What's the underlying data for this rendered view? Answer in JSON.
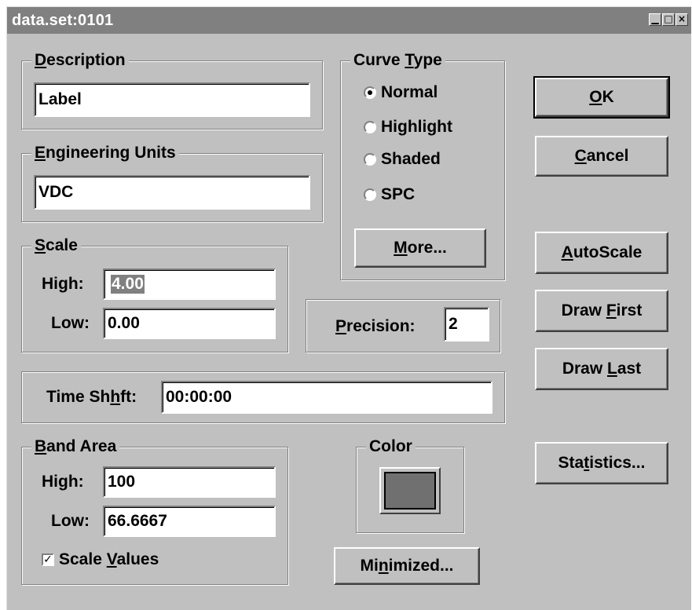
{
  "window": {
    "title": "data.set:0101",
    "controls": [
      "minimize-icon",
      "maximize-icon",
      "close-icon"
    ]
  },
  "description": {
    "group": "Description",
    "value": "Label"
  },
  "engineering_units": {
    "group": "Engineering Units",
    "value": "VDC"
  },
  "scale": {
    "group": "Scale",
    "high_label": "High:",
    "high_value": "4.00",
    "low_label": "Low:",
    "low_value": "0.00"
  },
  "curve_type": {
    "group": "Curve Type",
    "options": [
      "Normal",
      "Highlight",
      "Shaded",
      "SPC"
    ],
    "selected": "Normal",
    "more_button": "More..."
  },
  "precision": {
    "label": "Precision:",
    "value": "2"
  },
  "time_shift": {
    "label": "Time Shift:",
    "value": "00:00:00"
  },
  "band_area": {
    "group": "Band Area",
    "high_label": "High:",
    "high_value": "100",
    "low_label": "Low:",
    "low_value": "66.6667",
    "scale_values_label": "Scale Values",
    "scale_values_checked": true
  },
  "color": {
    "group": "Color",
    "swatch": "#707070"
  },
  "buttons": {
    "ok": "OK",
    "cancel": "Cancel",
    "autoscale": "AutoScale",
    "draw_first": "Draw First",
    "draw_last": "Draw Last",
    "statistics": "Statistics...",
    "minimized": "Minimized..."
  },
  "colors": {
    "face": "#c0c0c0",
    "title_bar": "#808080",
    "selection": "#808080"
  }
}
